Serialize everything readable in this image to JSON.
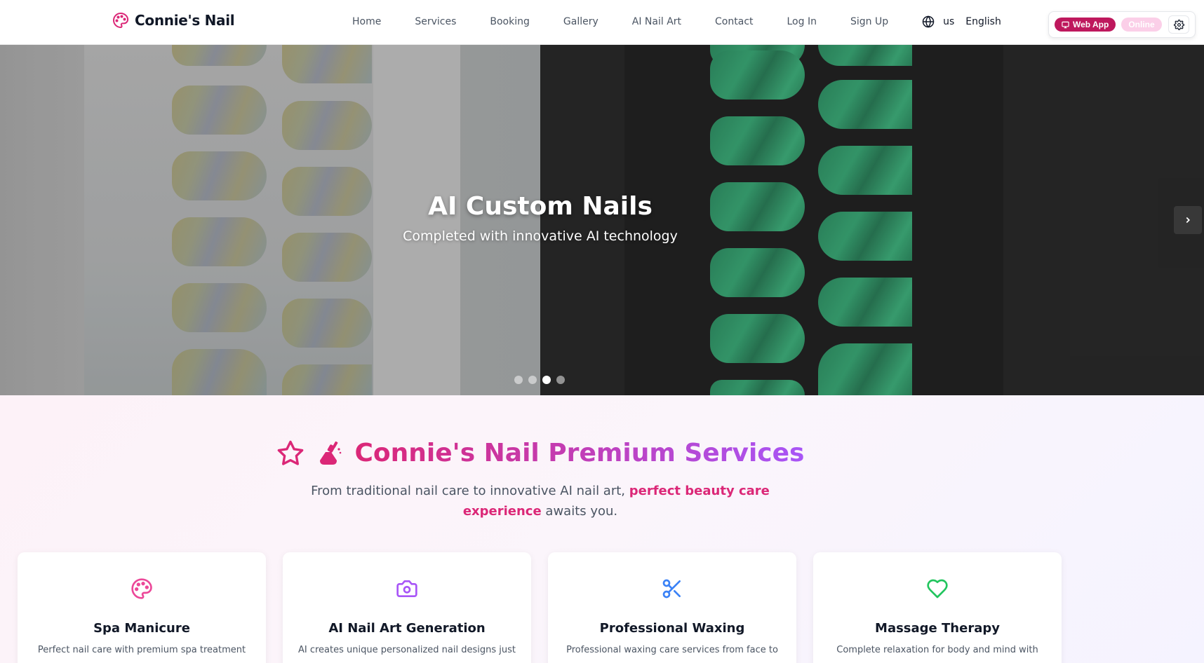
{
  "header": {
    "brand": "Connie's Nail",
    "nav": [
      "Home",
      "Services",
      "Booking",
      "Gallery",
      "AI Nail Art",
      "Contact",
      "Log In",
      "Sign Up"
    ],
    "region": "us",
    "language": "English",
    "webapp_label": "Web App",
    "status_label": "Online"
  },
  "hero": {
    "title": "AI Custom Nails",
    "subtitle": "Completed with innovative AI technology",
    "slide_count": 4,
    "active_slide": 3
  },
  "services": {
    "title": "Connie's Nail Premium Services",
    "desc_before": "From traditional nail care to innovative AI nail art,",
    "desc_highlight": "perfect beauty care experience",
    "desc_after": "awaits you.",
    "cards": [
      {
        "title": "Spa Manicure",
        "desc": "Perfect nail care with premium spa treatment",
        "icon": "palette-icon",
        "color": "#ec4899"
      },
      {
        "title": "AI Nail Art Generation",
        "desc": "AI creates unique personalized nail designs just",
        "icon": "camera-icon",
        "color": "#a855f7"
      },
      {
        "title": "Professional Waxing",
        "desc": "Professional waxing care services from face to",
        "icon": "scissors-icon",
        "color": "#3b82f6"
      },
      {
        "title": "Massage Therapy",
        "desc": "Complete relaxation for body and mind with",
        "icon": "heart-icon",
        "color": "#22c55e"
      }
    ]
  },
  "colors": {
    "brand": "#db2777",
    "accent": "#a855f7",
    "webapp": "#be185d"
  }
}
